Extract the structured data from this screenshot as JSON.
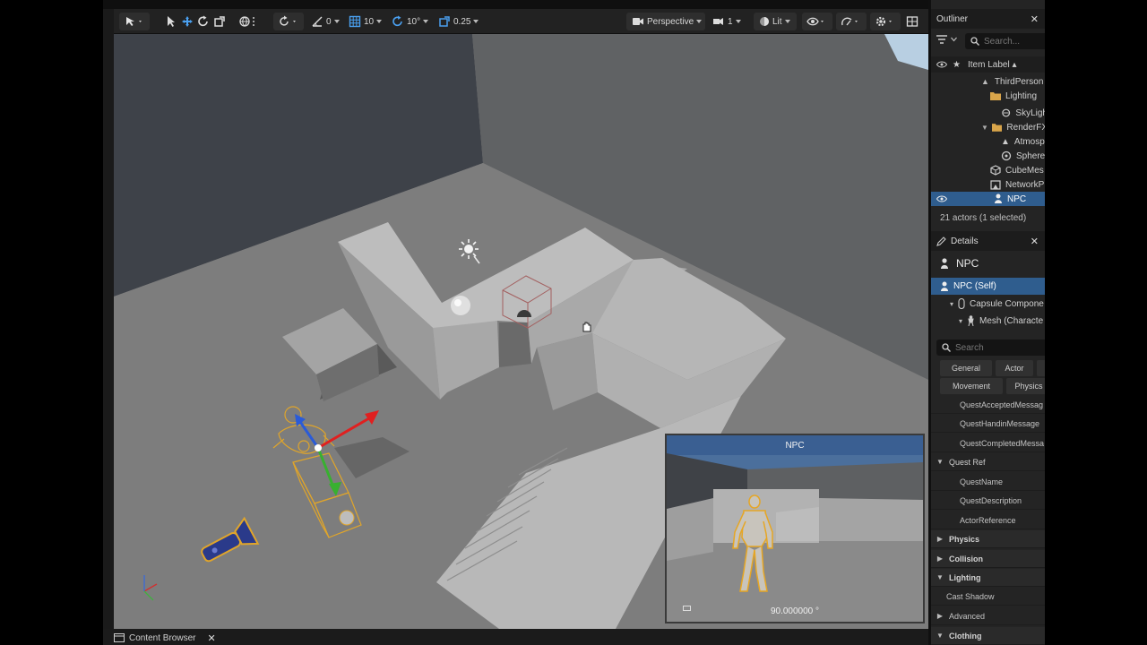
{
  "toolbar": {
    "snap_rotation": "0",
    "grid_size": "10",
    "rotation_snap": "10°",
    "scale_snap": "0.25",
    "view_mode": "Perspective",
    "camera_speed": "1",
    "lighting_mode": "Lit"
  },
  "viewport": {
    "pip_title": "NPC",
    "pip_fov": "90.000000 °"
  },
  "bottom": {
    "content_browser_label": "Content Browser"
  },
  "outliner": {
    "title": "Outliner",
    "search_placeholder": "Search...",
    "column_label": "Item Label ▴",
    "items": [
      {
        "label": "ThirdPerson"
      },
      {
        "label": "Lighting"
      },
      {
        "label": "SkyLigh"
      },
      {
        "label": "RenderFX"
      },
      {
        "label": "Atmosp"
      },
      {
        "label": "Sphere"
      },
      {
        "label": "CubeMes"
      },
      {
        "label": "NetworkP"
      },
      {
        "label": "NPC"
      }
    ],
    "status": "21 actors (1 selected)"
  },
  "details": {
    "title": "Details",
    "actor_name": "NPC",
    "components": [
      {
        "label": "NPC (Self)"
      },
      {
        "label": "Capsule Compone"
      },
      {
        "label": "Mesh (Characte"
      }
    ],
    "search_placeholder": "Search",
    "filters": [
      "General",
      "Actor",
      "Movement",
      "Physics"
    ],
    "properties": [
      {
        "label": "QuestAcceptedMessag"
      },
      {
        "label": "QuestHandinMessage"
      },
      {
        "label": "QuestCompletedMessa"
      }
    ],
    "quest_ref_section": "Quest Ref",
    "quest_ref_props": [
      {
        "label": "QuestName"
      },
      {
        "label": "QuestDescription"
      },
      {
        "label": "ActorReference"
      }
    ],
    "sections": [
      {
        "label": "Physics"
      },
      {
        "label": "Collision"
      },
      {
        "label": "Lighting"
      }
    ],
    "cast_shadow": "Cast Shadow",
    "advanced": "Advanced",
    "clothing": "Clothing"
  },
  "colors": {
    "selection": "#2f5d8e",
    "folder": "#d9a54a",
    "actor_outline": "#e0a52a"
  }
}
